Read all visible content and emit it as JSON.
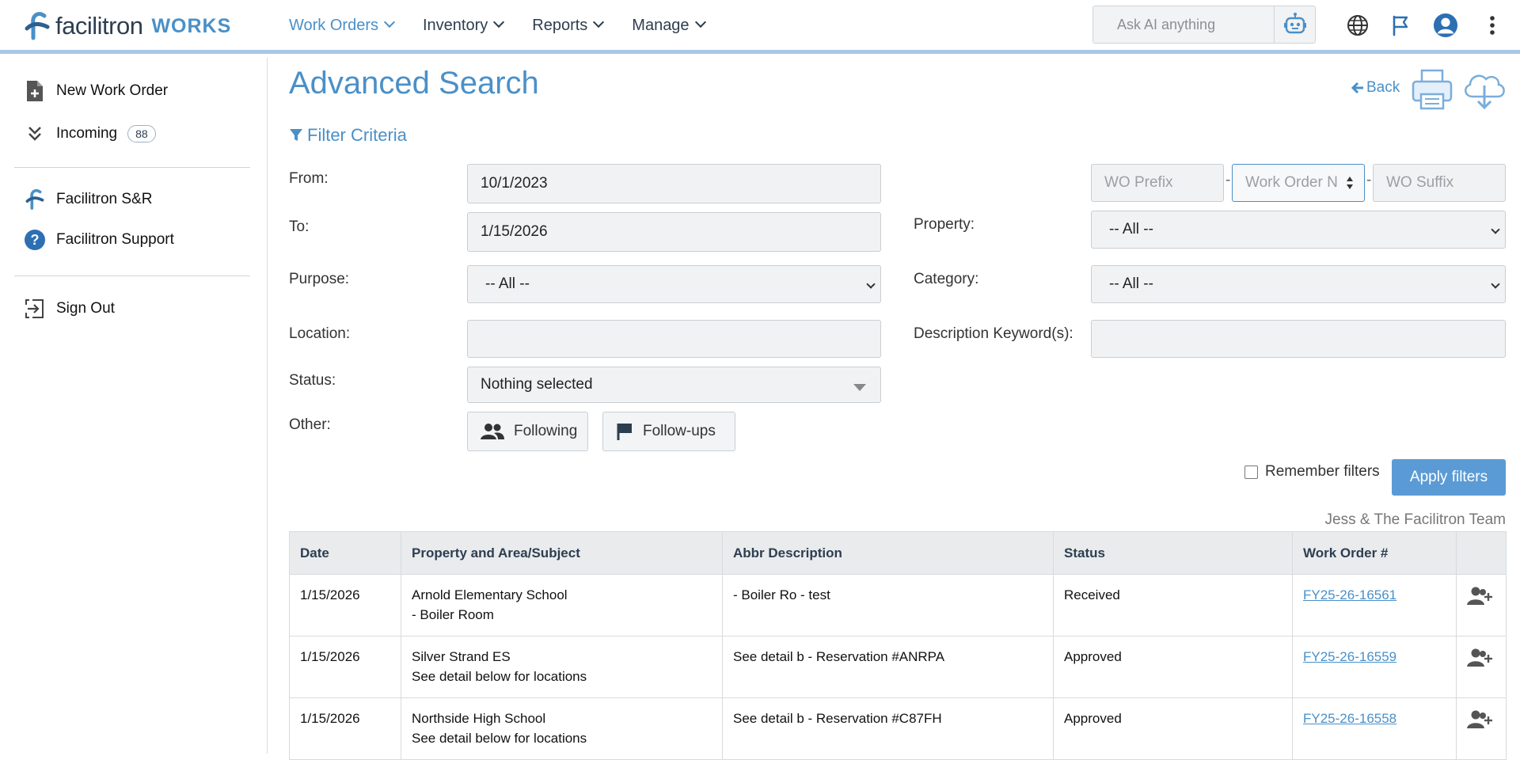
{
  "header": {
    "logo_text": "facilitron",
    "logo_works": "WORKS",
    "nav": [
      {
        "label": "Work Orders",
        "active": true
      },
      {
        "label": "Inventory",
        "active": false
      },
      {
        "label": "Reports",
        "active": false
      },
      {
        "label": "Manage",
        "active": false
      }
    ],
    "ai_placeholder": "Ask AI anything",
    "icons": [
      "robot-icon",
      "globe-icon",
      "flag-icon",
      "user-avatar-icon",
      "more-vertical-icon"
    ]
  },
  "sidebar": {
    "items": [
      {
        "label": "New Work Order",
        "icon": "new-document-icon"
      },
      {
        "label": "Incoming",
        "icon": "double-chevron-down-icon",
        "badge": "88"
      },
      {
        "label": "Facilitron S&R",
        "icon": "facilitron-logo-icon"
      },
      {
        "label": "Facilitron Support",
        "icon": "help-circle-icon"
      },
      {
        "label": "Sign Out",
        "icon": "sign-out-icon"
      }
    ]
  },
  "main": {
    "title": "Advanced Search",
    "back_label": "Back",
    "filter_heading": "Filter Criteria",
    "filters": {
      "from_label": "From:",
      "from_value": "10/1/2023",
      "to_label": "To:",
      "to_value": "1/15/2026",
      "purpose_label": "Purpose:",
      "purpose_value": "-- All --",
      "location_label": "Location:",
      "location_value": "",
      "status_label": "Status:",
      "status_value": "Nothing selected",
      "other_label": "Other:",
      "following_label": "Following",
      "followups_label": "Follow-ups",
      "wo_prefix_placeholder": "WO Prefix",
      "wo_number_placeholder": "Work Order N",
      "wo_suffix_placeholder": "WO Suffix",
      "dash": "-",
      "property_label": "Property:",
      "property_value": "-- All --",
      "category_label": "Category:",
      "category_value": "-- All --",
      "keywords_label": "Description Keyword(s):",
      "keywords_value": ""
    },
    "remember_label": "Remember filters",
    "remember_checked": false,
    "apply_label": "Apply filters",
    "team_note": "Jess & The Facilitron Team"
  },
  "table": {
    "columns": [
      "Date",
      "Property and Area/Subject",
      "Abbr Description",
      "Status",
      "Work Order #",
      ""
    ],
    "rows": [
      {
        "date": "1/15/2026",
        "property": "Arnold Elementary School",
        "area": "- Boiler Room",
        "description": "- Boiler Ro - test",
        "status": "Received",
        "wo": "FY25-26-16561"
      },
      {
        "date": "1/15/2026",
        "property": "Silver Strand ES",
        "area": "See detail below for locations",
        "description": "See detail b - Reservation #ANRPA",
        "status": "Approved",
        "wo": "FY25-26-16559"
      },
      {
        "date": "1/15/2026",
        "property": "Northside High School",
        "area": "See detail below for locations",
        "description": "See detail b - Reservation #C87FH",
        "status": "Approved",
        "wo": "FY25-26-16558"
      }
    ]
  },
  "colors": {
    "accent": "#4a90c8",
    "header_rule": "#a9c7e6",
    "apply_button": "#5b9bd5",
    "text_dark": "#2d3e50"
  }
}
